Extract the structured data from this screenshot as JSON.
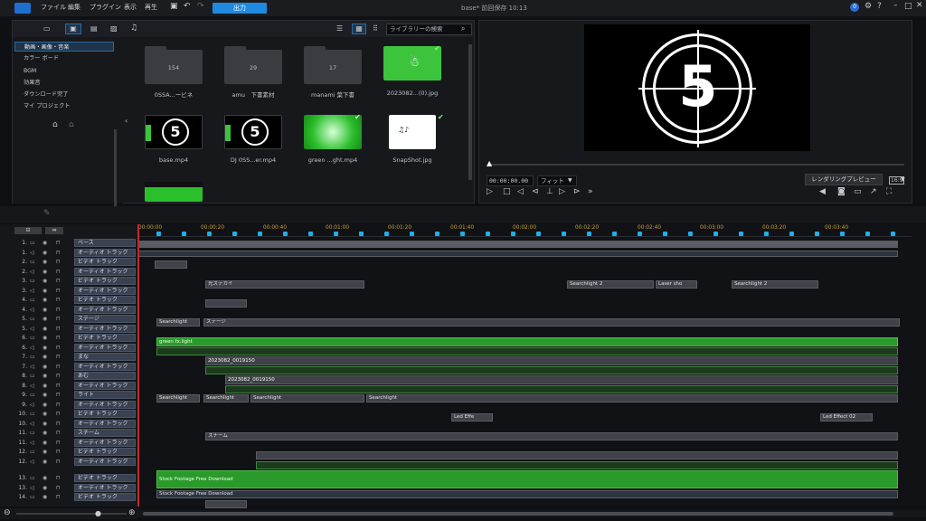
{
  "menu": {
    "items": [
      "ファイル",
      "編集",
      "プラグイン",
      "表示",
      "再生"
    ],
    "export": "出力",
    "title": "base* 前回保存 10:13"
  },
  "library": {
    "search_placeholder": "ライブラリーの検索",
    "sidebar": [
      "動画・画像・音楽",
      "カラー ボード",
      "BGM",
      "効果音",
      "ダウンロード完了",
      "マイ プロジェクト"
    ],
    "folders": [
      {
        "name": "0SSA...ービネ",
        "count": "154"
      },
      {
        "name": "amu　下書素材",
        "count": "29"
      },
      {
        "name": "manami 葉下書",
        "count": "17"
      }
    ],
    "files": [
      "2023082...(0).jpg",
      "base.mp4",
      "DJ 0SS...er.mp4",
      "green ...ght.mp4",
      "SnapShot.jpg"
    ]
  },
  "preview": {
    "countdown": "5",
    "timecode": "00:00:00.00",
    "fit": "フィット",
    "render": "レンダリングプレビュー",
    "aspect": "16:9"
  },
  "timeline": {
    "ticks": [
      "00:00:00",
      "00:00:20",
      "00:00:40",
      "00:01:00",
      "00:01:20",
      "00:01:40",
      "00:02:00",
      "00:02:20",
      "00:02:40",
      "00:03:00",
      "00:03:20",
      "00:03:40"
    ],
    "tracks": [
      {
        "num": "1.",
        "name": "ベース"
      },
      {
        "num": "1.",
        "name": "オーディオ トラック"
      },
      {
        "num": "2.",
        "name": "ビデオ トラック"
      },
      {
        "num": "2.",
        "name": "オーディオ トラック"
      },
      {
        "num": "3.",
        "name": "ビデオ トラック"
      },
      {
        "num": "3.",
        "name": "オーディオ トラック"
      },
      {
        "num": "4.",
        "name": "ビデオ トラック"
      },
      {
        "num": "4.",
        "name": "オーディオ トラック"
      },
      {
        "num": "5.",
        "name": "ステージ"
      },
      {
        "num": "5.",
        "name": "オーディオ トラック"
      },
      {
        "num": "6.",
        "name": "ビデオ トラック"
      },
      {
        "num": "6.",
        "name": "オーディオ トラック"
      },
      {
        "num": "7.",
        "name": "まな"
      },
      {
        "num": "7.",
        "name": "オーディオ トラック"
      },
      {
        "num": "8.",
        "name": "あむ"
      },
      {
        "num": "8.",
        "name": "オーディオ トラック"
      },
      {
        "num": "9.",
        "name": "ライト"
      },
      {
        "num": "9.",
        "name": "オーディオ トラック"
      },
      {
        "num": "10.",
        "name": "ビデオ トラック"
      },
      {
        "num": "10.",
        "name": "オーディオ トラック"
      },
      {
        "num": "11.",
        "name": "スチーム"
      },
      {
        "num": "11.",
        "name": "オーディオ トラック"
      },
      {
        "num": "12.",
        "name": "ビデオ トラック"
      },
      {
        "num": "12.",
        "name": "オーディオ トラック"
      },
      {
        "num": "13.",
        "name": "ビデオ トラック"
      },
      {
        "num": "13.",
        "name": "オーディオ トラック"
      },
      {
        "num": "14.",
        "name": "ビデオ トラック"
      }
    ],
    "clips": {
      "searchlight": "Searchlight",
      "searchlight2": "Searchlight 2",
      "lasershow": "Laser sho",
      "stage": "ステージ",
      "ledeffect": "Led Effe",
      "ledeffect2": "Led Effect 02",
      "steam": "スチーム",
      "stock": "Stock Footage Free Download",
      "greenfx": "green fx.light",
      "date1": "2023082_0019150",
      "hikari": "光ステカイ"
    }
  },
  "colors": {
    "accent": "#1f8ae0",
    "clip_green": "#2a9a2a",
    "playhead": "#c02a2a"
  }
}
